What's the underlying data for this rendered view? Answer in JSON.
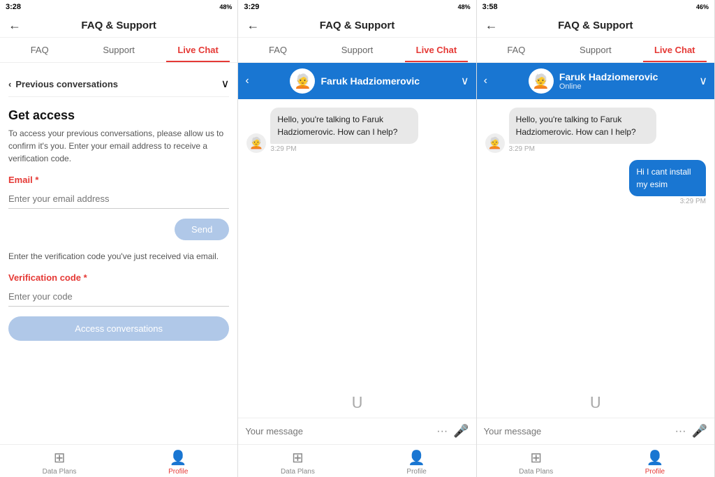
{
  "screens": [
    {
      "id": "screen1",
      "statusBar": {
        "time": "3:28",
        "battery": "48%"
      },
      "header": {
        "title": "FAQ & Support",
        "backLabel": "←"
      },
      "tabs": [
        {
          "label": "FAQ",
          "active": false
        },
        {
          "label": "Support",
          "active": false
        },
        {
          "label": "Live Chat",
          "active": true
        }
      ],
      "prevConv": {
        "label": "Previous conversations",
        "backIcon": "‹",
        "chevronIcon": "∨"
      },
      "getAccess": {
        "title": "Get access",
        "desc": "To access your previous conversations, please allow us to confirm it's you. Enter your email address to receive a verification code.",
        "emailLabel": "Email",
        "emailRequired": "*",
        "emailPlaceholder": "Enter your email address",
        "sendBtn": "Send",
        "verifyNote": "Enter the verification code you've just received via email.",
        "codeLabel": "Verification code",
        "codeRequired": "*",
        "codePlaceholder": "Enter your code",
        "accessBtn": "Access conversations"
      },
      "bottomNav": [
        {
          "label": "Data Plans",
          "icon": "▦",
          "active": false
        },
        {
          "label": "Profile",
          "icon": "👤",
          "active": true
        }
      ]
    },
    {
      "id": "screen2",
      "statusBar": {
        "time": "3:29",
        "battery": "48%"
      },
      "header": {
        "title": "FAQ & Support",
        "backLabel": "←"
      },
      "tabs": [
        {
          "label": "FAQ",
          "active": false
        },
        {
          "label": "Support",
          "active": false
        },
        {
          "label": "Live Chat",
          "active": true
        }
      ],
      "agentBar": {
        "backIcon": "‹",
        "agentEmoji": "🧑‍🦳",
        "agentName": "Faruk Hadziomerovic",
        "chevronIcon": "∨"
      },
      "messages": [
        {
          "type": "agent",
          "text": "Hello, you're talking to Faruk Hadziomerovic. How can I help?",
          "time": "3:29 PM"
        }
      ],
      "chatLogo": "ᑌ",
      "inputPlaceholder": "Your message",
      "bottomNav": [
        {
          "label": "Data Plans",
          "icon": "▦",
          "active": false
        },
        {
          "label": "Profile",
          "icon": "👤",
          "active": false
        }
      ]
    },
    {
      "id": "screen3",
      "statusBar": {
        "time": "3:58",
        "battery": "46%"
      },
      "header": {
        "title": "FAQ & Support",
        "backLabel": "←"
      },
      "tabs": [
        {
          "label": "FAQ",
          "active": false
        },
        {
          "label": "Support",
          "active": false
        },
        {
          "label": "Live Chat",
          "active": true
        }
      ],
      "agentBar": {
        "backIcon": "‹",
        "agentEmoji": "🧑‍🦳",
        "agentName": "Faruk Hadziomerovic",
        "agentStatus": "Online",
        "chevronIcon": "∨"
      },
      "messages": [
        {
          "type": "agent",
          "text": "Hello, you're talking to Faruk Hadziomerovic. How can I help?",
          "time": "3:29 PM"
        },
        {
          "type": "user",
          "text": "Hi I cant install my esim",
          "time": "3:29 PM"
        }
      ],
      "chatLogo": "ᑌ",
      "inputPlaceholder": "Your message",
      "bottomNav": [
        {
          "label": "Data Plans",
          "icon": "▦",
          "active": false
        },
        {
          "label": "Profile",
          "icon": "👤",
          "active": true
        }
      ]
    }
  ]
}
